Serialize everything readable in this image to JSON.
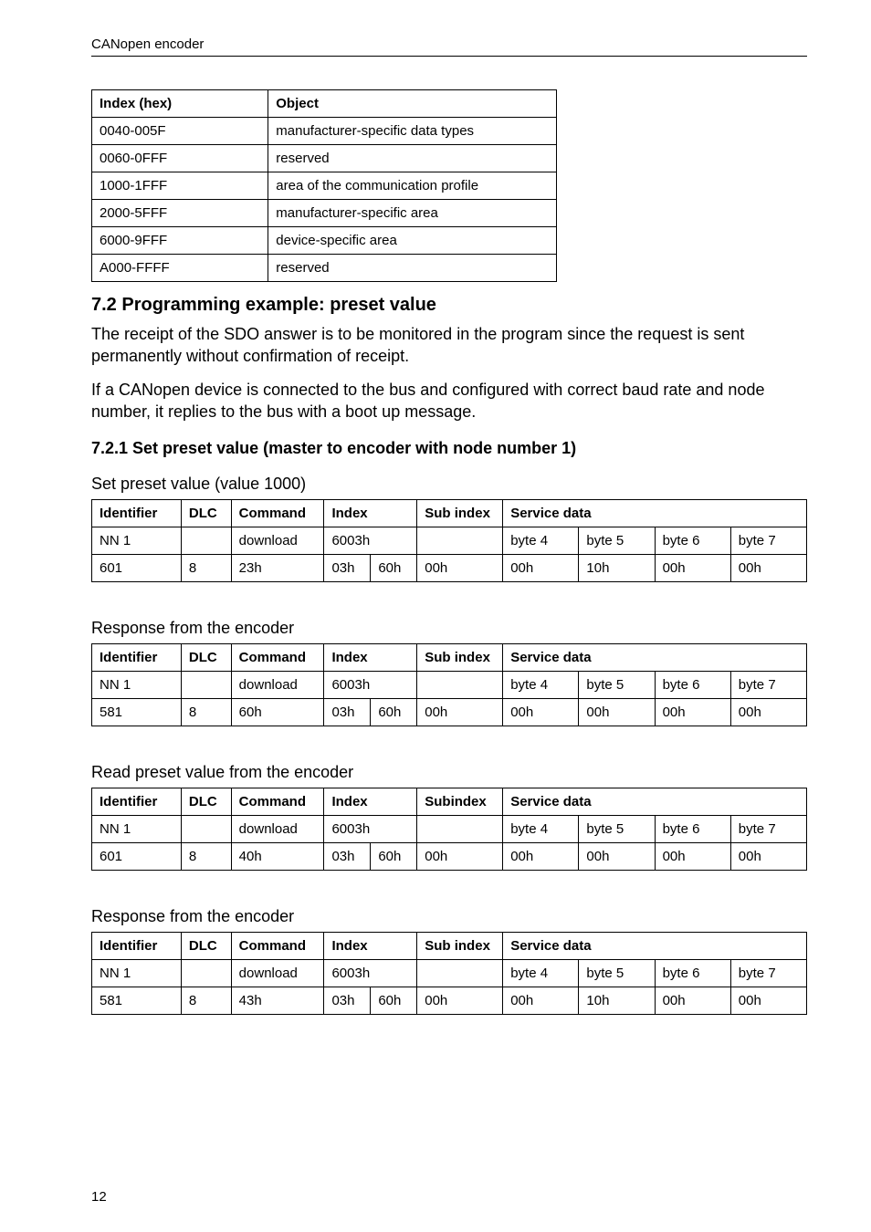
{
  "header": "CANopen encoder",
  "page_number": "12",
  "index_table": {
    "headers": [
      "Index (hex)",
      "Object"
    ],
    "rows": [
      [
        "0040-005F",
        "manufacturer-specific data types"
      ],
      [
        "0060-0FFF",
        "reserved"
      ],
      [
        "1000-1FFF",
        "area of the communication profile"
      ],
      [
        "2000-5FFF",
        "manufacturer-specific area"
      ],
      [
        "6000-9FFF",
        "device-specific area"
      ],
      [
        "A000-FFFF",
        "reserved"
      ]
    ]
  },
  "section72": {
    "heading": "7.2  Programming example: preset value",
    "para1": "The receipt of the SDO answer is to be monitored in the program since the request is sent permanently without confirmation of receipt.",
    "para2": "If a CANopen device is connected to the bus and configured with correct baud rate and node number, it replies to the bus with a boot up message."
  },
  "section721": {
    "heading": "7.2.1  Set preset value (master to encoder with node number 1)",
    "caption": "Set preset value (value 1000)"
  },
  "identifier_header_sub": {
    "h": [
      "Identifier",
      "DLC",
      "Command",
      "Index",
      "Sub index",
      "Service data"
    ]
  },
  "identifier_header_subx": {
    "h": [
      "Identifier",
      "DLC",
      "Command",
      "Index",
      "Subindex",
      "Service data"
    ]
  },
  "nn_row": {
    "id": "NN 1",
    "dlc": "",
    "cmd": "download",
    "index": "6003h",
    "sub": "",
    "b4": "byte 4",
    "b5": "byte 5",
    "b6": "byte 6",
    "b7": "byte 7"
  },
  "table1_data": {
    "id": "601",
    "dlc": "8",
    "cmd": "23h",
    "i1": "03h",
    "i2": "60h",
    "sub": "00h",
    "b4": "00h",
    "b5": "10h",
    "b6": "00h",
    "b7": "00h"
  },
  "caption_resp1": "Response from the encoder",
  "table2_data": {
    "id": "581",
    "dlc": "8",
    "cmd": "60h",
    "i1": "03h",
    "i2": "60h",
    "sub": "00h",
    "b4": "00h",
    "b5": "00h",
    "b6": "00h",
    "b7": "00h"
  },
  "caption_read": "Read preset value from the encoder",
  "table3_data": {
    "id": "601",
    "dlc": "8",
    "cmd": "40h",
    "i1": "03h",
    "i2": "60h",
    "sub": "00h",
    "b4": "00h",
    "b5": "00h",
    "b6": "00h",
    "b7": "00h"
  },
  "caption_resp2": "Response from the encoder",
  "table4_data": {
    "id": "581",
    "dlc": "8",
    "cmd": "43h",
    "i1": "03h",
    "i2": "60h",
    "sub": "00h",
    "b4": "00h",
    "b5": "10h",
    "b6": "00h",
    "b7": "00h"
  }
}
